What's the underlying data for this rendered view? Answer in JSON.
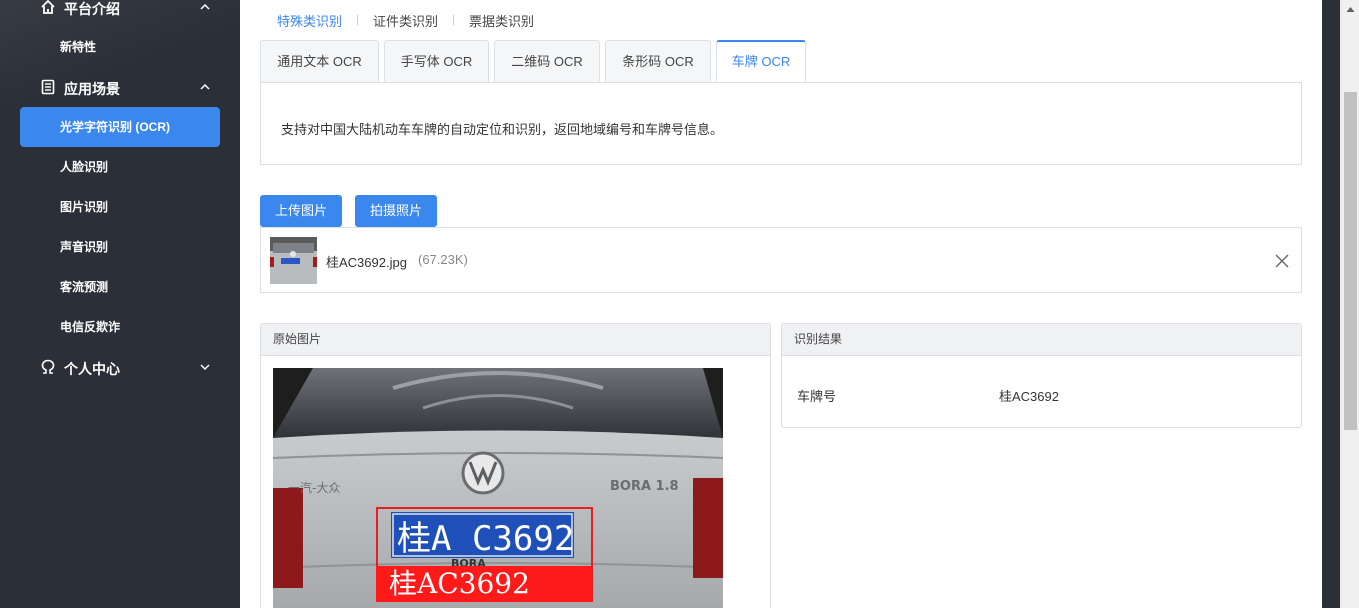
{
  "sidebar": {
    "groups": [
      {
        "label": "平台介绍",
        "icon": "home-icon",
        "chevron": "chevron-up-icon"
      },
      {
        "label": "应用场景",
        "icon": "document-icon",
        "chevron": "chevron-up-icon"
      },
      {
        "label": "个人中心",
        "icon": "user-icon",
        "chevron": "chevron-down-icon"
      }
    ],
    "items": [
      {
        "label": "新特性"
      },
      {
        "label": "光学字符识别 (OCR)",
        "active": true
      },
      {
        "label": "人脸识别"
      },
      {
        "label": "图片识别"
      },
      {
        "label": "声音识别"
      },
      {
        "label": "客流预测"
      },
      {
        "label": "电信反欺诈"
      }
    ]
  },
  "category_tabs": [
    {
      "label": "特殊类识别",
      "active": true
    },
    {
      "label": "证件类识别"
    },
    {
      "label": "票据类识别"
    }
  ],
  "ocr_tabs": [
    {
      "label": "通用文本 OCR"
    },
    {
      "label": "手写体 OCR"
    },
    {
      "label": "二维码 OCR"
    },
    {
      "label": "条形码 OCR"
    },
    {
      "label": "车牌 OCR",
      "active": true
    }
  ],
  "description": "支持对中国大陆机动车车牌的自动定位和识别，返回地域编号和车牌号信息。",
  "buttons": {
    "upload": "上传图片",
    "capture": "拍摄照片"
  },
  "file": {
    "name": "桂AC3692.jpg",
    "size": "(67.23K)"
  },
  "panels": {
    "original_title": "原始图片",
    "result_title": "识别结果",
    "result_key": "车牌号",
    "result_value": "桂AC3692"
  },
  "image_text": {
    "plate": "桂A C3692",
    "overlay": "桂AC3692",
    "brand": "BORA",
    "badge_left": "一汽-大众",
    "badge_right": "BORA 1.8"
  },
  "colors": {
    "accent": "#3a87ee",
    "sidebar_bg": "#2b2f37",
    "overlay_red": "#ff1a1a",
    "plate_blue": "#1f4fb8"
  }
}
